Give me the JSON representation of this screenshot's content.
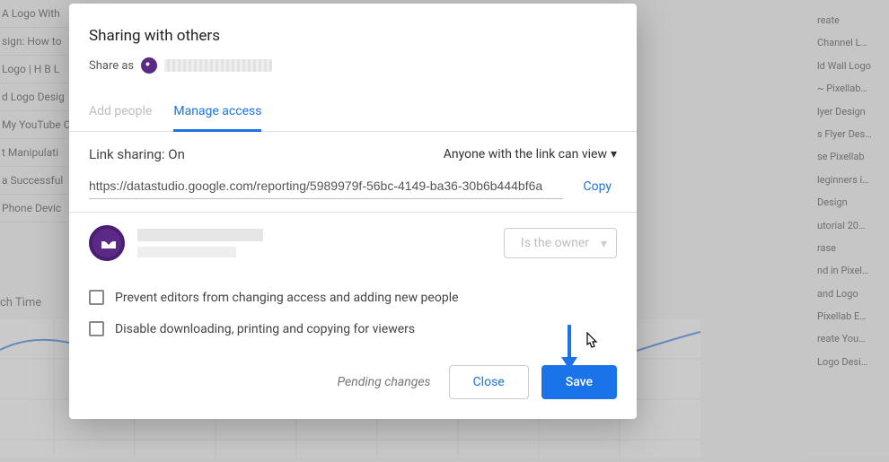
{
  "bg": {
    "left_items": [
      "A Logo With",
      "sign: How to",
      "Logo | H B L",
      "d Logo Desig",
      "My YouTube C",
      "t Manipulati",
      "a Successful",
      "Phone Devic"
    ],
    "right_items": [
      "reate",
      "Channel L…",
      "ld Wall Logo",
      "~ Pixellab…",
      "lyer Design",
      "s Flyer Des…",
      "se Pixellab",
      "leginners i…",
      "Design",
      "utorial 20…",
      "rase",
      "nd in Pixel…",
      "and Logo",
      "Pixellab E…",
      "reate You…",
      "Logo Desi…"
    ],
    "watch_label": "ch Time"
  },
  "modal": {
    "title": "Sharing with others",
    "share_as": "Share as",
    "tabs": {
      "add_people": "Add people",
      "manage": "Manage access"
    },
    "linkshare": {
      "label": "Link sharing: On",
      "dropdown": "Anyone with the link can view",
      "url": "https://datastudio.google.com/reporting/5989979f-56bc-4149-ba36-30b6b444bf6a",
      "copy": "Copy"
    },
    "owner_badge": "Is the owner",
    "opts": {
      "prevent": "Prevent editors from changing access and adding new people",
      "disable": "Disable downloading, printing and copying for viewers"
    },
    "footer": {
      "pending": "Pending changes",
      "close": "Close",
      "save": "Save"
    }
  }
}
